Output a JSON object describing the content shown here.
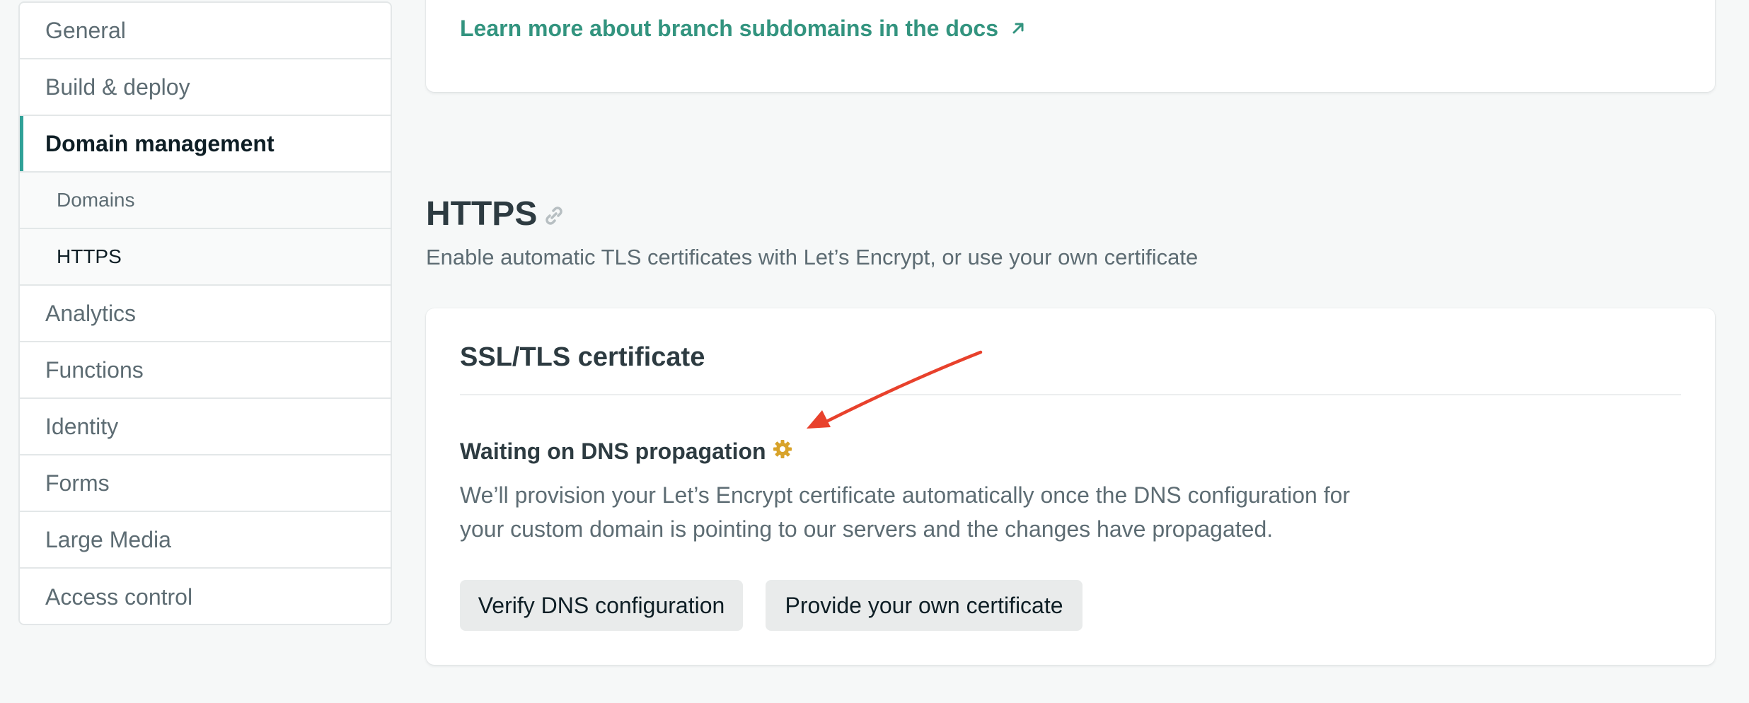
{
  "sidebar": {
    "items": [
      {
        "label": "General"
      },
      {
        "label": "Build & deploy"
      },
      {
        "label": "Domain management"
      },
      {
        "label": "Domains"
      },
      {
        "label": "HTTPS"
      },
      {
        "label": "Analytics"
      },
      {
        "label": "Functions"
      },
      {
        "label": "Identity"
      },
      {
        "label": "Forms"
      },
      {
        "label": "Large Media"
      },
      {
        "label": "Access control"
      }
    ]
  },
  "top_card": {
    "link_label": "Learn more about branch subdomains in the docs",
    "link_icon": "arrow-up-right-icon"
  },
  "https_section": {
    "title": "HTTPS",
    "title_icon": "link-icon",
    "description": "Enable automatic TLS certificates with Let’s Encrypt, or use your own certificate"
  },
  "ssl_card": {
    "title": "SSL/TLS certificate",
    "status": "Waiting on DNS propagation",
    "status_icon": "gear-icon",
    "description": "We’ll provision your Let’s Encrypt certificate automatically once the DNS configuration for your custom domain is pointing to our servers and the changes have propagated.",
    "buttons": {
      "verify": "Verify DNS configuration",
      "provide": "Provide your own certificate"
    }
  },
  "colors": {
    "accent": "#30a197",
    "link": "#33947f",
    "gear": "#d8a32a",
    "annotation": "#e8412c"
  }
}
